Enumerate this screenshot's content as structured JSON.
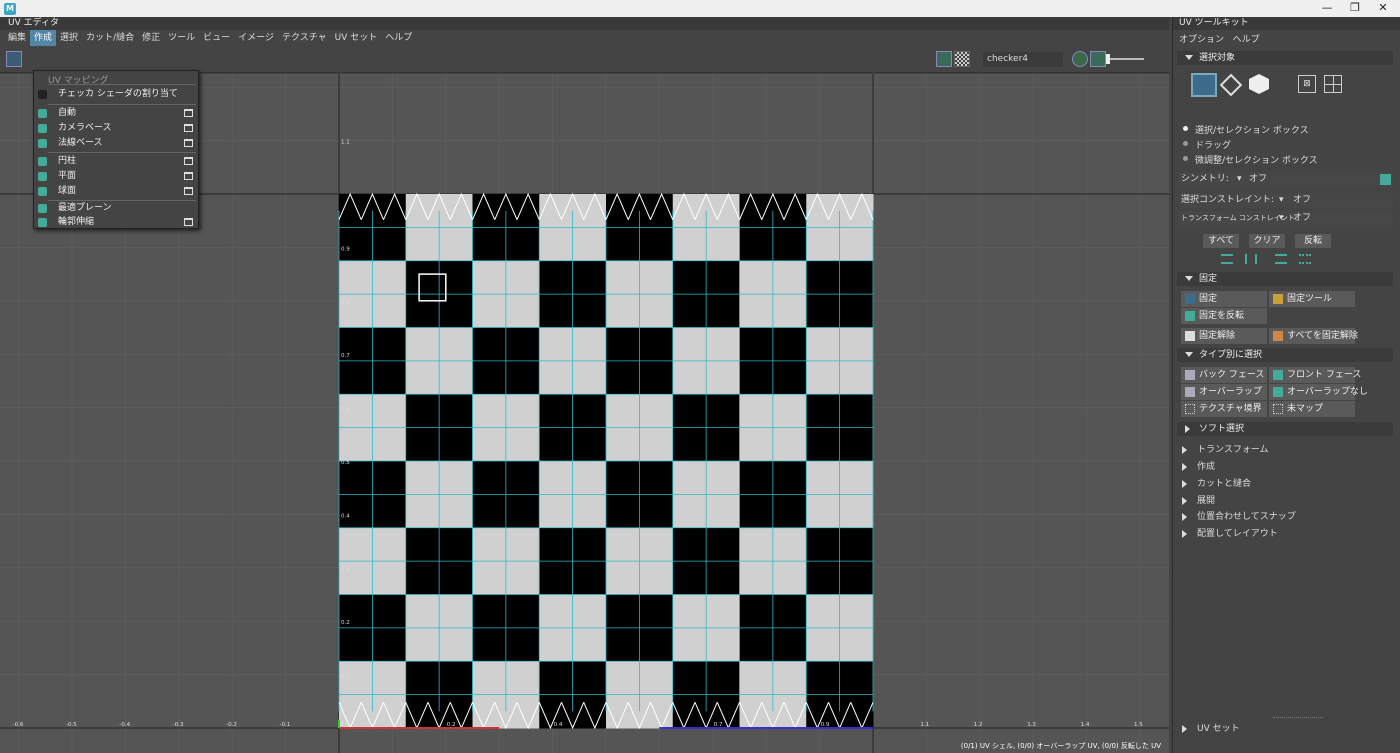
{
  "titlebar": {
    "app_icon": "M",
    "minimize": "—",
    "maximize": "❐",
    "close": "✕"
  },
  "editor": {
    "title": "UV エディタ",
    "menus": [
      "編集",
      "作成",
      "選択",
      "カット/縫合",
      "修正",
      "ツール",
      "ビュー",
      "イメージ",
      "テクスチャ",
      "UV セット",
      "ヘルプ"
    ],
    "active_menu_index": 1,
    "texture_dropdown": "checker4",
    "status": "(0/1) UV シェル, (0/0) オーバーラップ UV, (0/0) 反転した UV",
    "grid_labels": {
      "y": [
        "1.1",
        "0.9",
        "0.8",
        "0.7",
        "0.6",
        "0.5",
        "0.4",
        "0.3",
        "0.2",
        "0.1"
      ],
      "x_left": [
        "-0.6",
        "-0.5",
        "-0.4",
        "-0.3",
        "-0.2",
        "-0.1"
      ],
      "x_bottom": [
        "0",
        "0.1",
        "0.2",
        "0.3",
        "0.4",
        "0.5",
        "0.6",
        "0.7",
        "0.8",
        "0.9"
      ],
      "x_right": [
        "1.1",
        "1.2",
        "1.3",
        "1.4",
        "1.5"
      ]
    }
  },
  "dropdown": {
    "header": "UV マッピング",
    "items": [
      {
        "label": "チェッカ シェーダの割り当て",
        "option": false
      },
      {
        "label": "自動",
        "option": true
      },
      {
        "label": "カメラベース",
        "option": true
      },
      {
        "label": "法線ベース",
        "option": true
      },
      {
        "label": "円柱",
        "option": true
      },
      {
        "label": "平面",
        "option": true
      },
      {
        "label": "球面",
        "option": true
      },
      {
        "label": "最適プレーン",
        "option": false
      },
      {
        "label": "輪郭伸縮",
        "option": true
      }
    ]
  },
  "toolkit": {
    "title": "UV ツールキット",
    "menus": [
      "オプション",
      "ヘルプ"
    ],
    "sel_section": "選択対象",
    "radios": [
      "選択/セレクション ボックス",
      "ドラッグ",
      "微調整/セレクション ボックス"
    ],
    "symmetry_label": "シンメトリ:",
    "symmetry_value": "オフ",
    "sel_constraint_label": "選択コンストレイント:",
    "sel_constraint_value": "オフ",
    "xform_constraint_label": "トランスフォーム コンストレイント:",
    "xform_constraint_value": "オフ",
    "btn_all": "すべて",
    "btn_clear": "クリア",
    "btn_invert": "反転",
    "pin_section": "固定",
    "pin": "固定",
    "pin_tool": "固定ツール",
    "pin_invert": "固定を反転",
    "unpin": "固定解除",
    "unpin_all": "すべてを固定解除",
    "type_section": "タイプ別に選択",
    "back_face": "バック フェース",
    "front_face": "フロント フェース",
    "overlap": "オーバーラップ",
    "no_overlap": "オーバーラップなし",
    "tex_border": "テクスチャ境界",
    "unmapped": "未マップ",
    "soft_sel": "ソフト選択",
    "collapsed": [
      "トランスフォーム",
      "作成",
      "カットと縫合",
      "展開",
      "位置合わせしてスナップ",
      "配置してレイアウト"
    ],
    "uv_set": "UV セット"
  },
  "colors": {
    "accent": "#5285a6",
    "uv_lines": "#2fb8c8",
    "checker_dark": "#000000",
    "checker_light": "#d0d0d0"
  }
}
